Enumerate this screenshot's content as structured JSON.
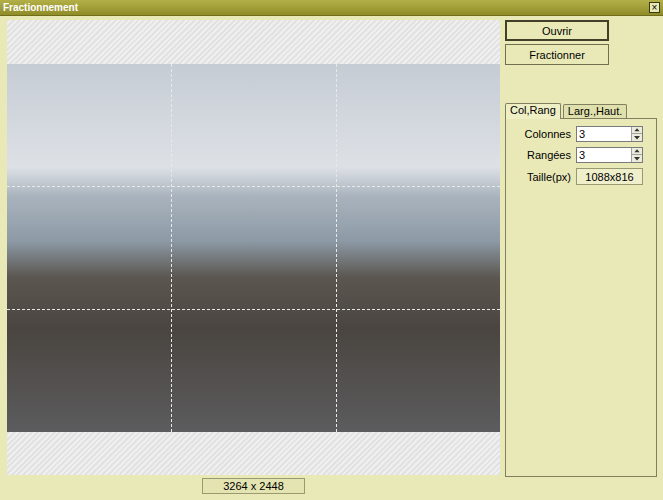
{
  "window": {
    "title": "Fractionnement",
    "close": "×"
  },
  "preview": {
    "image_size": "3264 x 2448"
  },
  "buttons": [
    {
      "label": "Ouvrir",
      "default": true
    },
    {
      "label": "Fractionner",
      "default": false
    }
  ],
  "tabs": [
    {
      "label": "Col,Rang",
      "selected": true
    },
    {
      "label": "Larg.,Haut.",
      "selected": false
    }
  ],
  "fields": [
    {
      "label": "Colonnes",
      "value": "3",
      "kind": "spin"
    },
    {
      "label": "Rangées",
      "value": "3",
      "kind": "spin"
    },
    {
      "label": "Taille(px)",
      "value": "1088x816",
      "kind": "readout"
    }
  ]
}
